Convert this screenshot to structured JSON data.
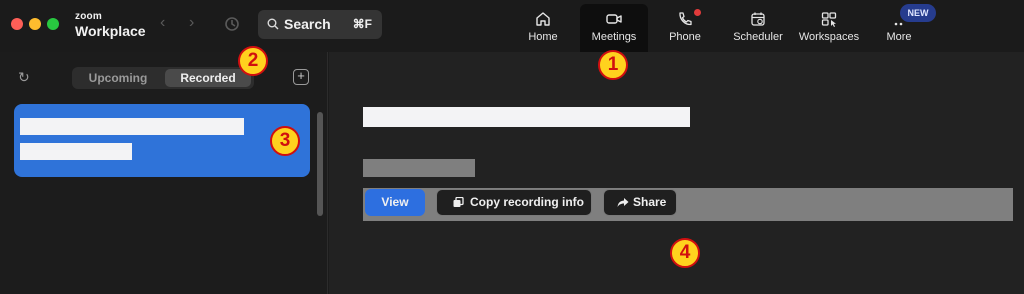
{
  "app": {
    "brand_top": "zoom",
    "brand_bottom": "Workplace"
  },
  "search": {
    "label": "Search",
    "shortcut": "⌘F"
  },
  "tabs": [
    {
      "label": "Home",
      "icon": "home-icon"
    },
    {
      "label": "Meetings",
      "icon": "video-camera-icon",
      "active": true
    },
    {
      "label": "Phone",
      "icon": "phone-icon",
      "notification_dot": true
    },
    {
      "label": "Scheduler",
      "icon": "calendar-clock-icon"
    },
    {
      "label": "Workspaces",
      "icon": "workspaces-icon"
    },
    {
      "label": "More",
      "icon": "more-dots-icon",
      "badge": "NEW"
    }
  ],
  "sidebar": {
    "segments": [
      "Upcoming",
      "Recorded"
    ],
    "selected_segment": "Recorded"
  },
  "actions": {
    "view": "View",
    "copy": "Copy recording info",
    "share": "Share"
  },
  "callouts": [
    "1",
    "2",
    "3",
    "4"
  ],
  "colors": {
    "accent": "#2d6fe0",
    "selected_item": "#2f73d9",
    "callout_fill": "#ffd21e",
    "callout_border": "#d10f0f",
    "notification": "#e23b3b"
  }
}
